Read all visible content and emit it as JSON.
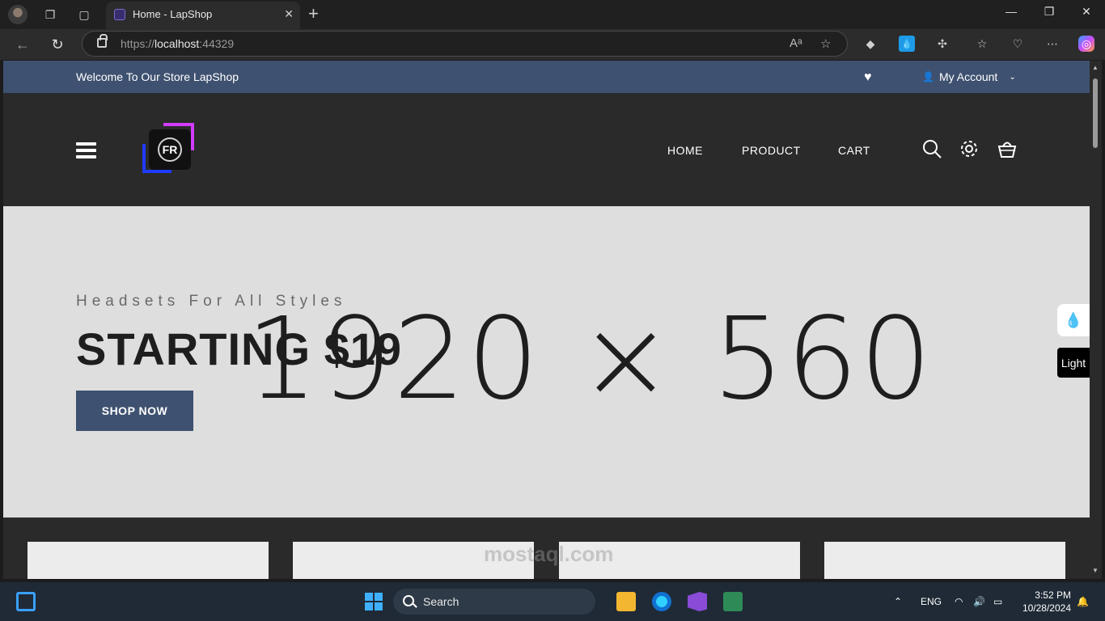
{
  "browser": {
    "tab_title": "Home - LapShop",
    "url_prefix": "https://",
    "url_host": "localhost",
    "url_port": ":44329"
  },
  "topbar": {
    "welcome": "Welcome To Our Store LapShop",
    "account": "My Account"
  },
  "header": {
    "logo_text": "FR",
    "nav": [
      "HOME",
      "PRODUCT",
      "CART"
    ]
  },
  "hero": {
    "placeholder": "1920 × 560",
    "subtitle": "Headsets For All Styles",
    "headline": "STARTING $19",
    "button": "SHOP NOW"
  },
  "side": {
    "theme": "Light"
  },
  "taskbar": {
    "search": "Search",
    "lang": "ENG",
    "time": "3:52 PM",
    "date": "10/28/2024"
  },
  "watermark": "mostaql.com",
  "colors": {
    "topbar": "#3e5170",
    "header_bg": "#2a2a2a",
    "hero_bg": "#dedede",
    "button": "#3e5170"
  }
}
